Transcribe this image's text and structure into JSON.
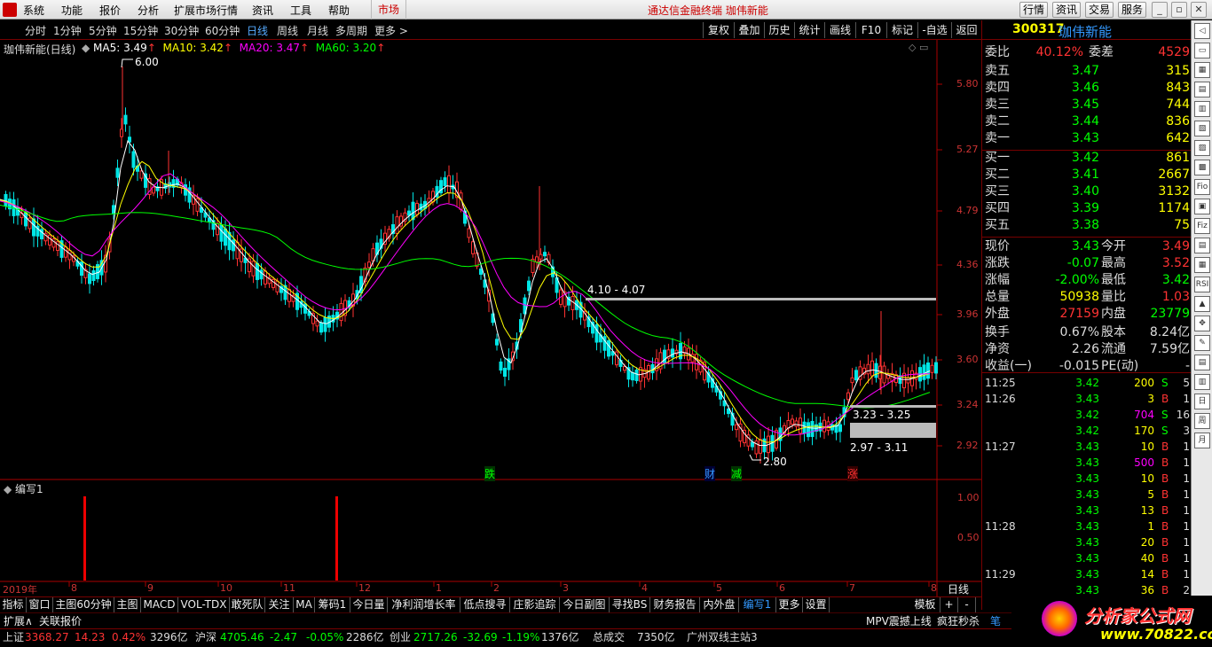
{
  "menubar": {
    "items": [
      "系统",
      "功能",
      "报价",
      "分析",
      "扩展市场行情",
      "资讯",
      "工具",
      "帮助"
    ],
    "market": "市场",
    "title": "通达信金融终端  珈伟新能",
    "right_buttons": [
      "行情",
      "资讯",
      "交易",
      "服务"
    ]
  },
  "toolbar": {
    "periods": [
      "分时",
      "1分钟",
      "5分钟",
      "15分钟",
      "30分钟",
      "60分钟",
      "日线",
      "周线",
      "月线",
      "多周期",
      "更多 >"
    ],
    "active_period": "日线",
    "buttons": [
      "复权",
      "叠加",
      "历史",
      "统计",
      "画线",
      "F10",
      "标记",
      "-自选",
      "返回"
    ]
  },
  "chart": {
    "title": "珈伟新能(日线)",
    "ma": [
      {
        "label": "MA5: 3.49",
        "color": "#ffffff"
      },
      {
        "label": "MA10: 3.42",
        "color": "#ffff00"
      },
      {
        "label": "MA20: 3.47",
        "color": "#ff00ff"
      },
      {
        "label": "MA60: 3.20",
        "color": "#00ff00"
      }
    ],
    "price_labels": [
      "5.80",
      "5.27",
      "4.79",
      "4.36",
      "3.96",
      "3.60",
      "3.24",
      "2.92"
    ],
    "annotations": {
      "high": "6.00",
      "low": "2.80",
      "box1": "4.10 - 4.07",
      "box2": "3.23 - 3.25",
      "box3": "2.97 - 3.11"
    },
    "markers": [
      "跌",
      "财",
      "减",
      "涨"
    ],
    "indicator_title": "编写1",
    "indicator_labels": [
      "1.00",
      "0.50"
    ],
    "date_labels": [
      "2019年",
      "8",
      "9",
      "10",
      "11",
      "12",
      "1",
      "2",
      "3",
      "4",
      "5",
      "6",
      "7",
      "8"
    ],
    "period_label": "日线"
  },
  "tabs": [
    "指标",
    "窗口",
    "主图60分钟",
    "主图",
    "MACD",
    "VOL-TDX",
    "敢死队",
    "关注",
    "MA",
    "筹码1",
    "今日量",
    "净利润增长率",
    "低点搜寻",
    "庄影追踪",
    "今日副图",
    "寻找BS",
    "财务报告",
    "内外盘",
    "编写1",
    "更多",
    "设置"
  ],
  "active_tab": "编写1",
  "tabs_right": [
    "模板",
    "+",
    "-"
  ],
  "idxbar": {
    "left": [
      "扩展∧",
      "关联报价"
    ],
    "right": [
      "MPV震撼上线",
      "疯狂秒杀",
      "笔",
      "价"
    ]
  },
  "ticker": {
    "items": [
      {
        "name": "上证",
        "v": "3368.27",
        "c": "14.23",
        "p": "0.42%",
        "amt": "3296亿"
      },
      {
        "name": "沪深",
        "v": "4705.46",
        "c": "-2.47",
        "p": "-0.05%",
        "amt": "2286亿"
      },
      {
        "name": "创业",
        "v": "2717.26",
        "c": "-32.69",
        "p": "-1.19%",
        "amt": "1376亿"
      }
    ],
    "total_label": "总成交",
    "total": "7350亿",
    "station": "广州双线主站3"
  },
  "quote": {
    "code": "300317",
    "name": "珈伟新能",
    "weibi": "40.12%",
    "weicha": "4529",
    "weibi_label": "委比",
    "weicha_label": "委差",
    "sells": [
      {
        "l": "卖五",
        "p": "3.47",
        "v": "315"
      },
      {
        "l": "卖四",
        "p": "3.46",
        "v": "843"
      },
      {
        "l": "卖三",
        "p": "3.45",
        "v": "744"
      },
      {
        "l": "卖二",
        "p": "3.44",
        "v": "836"
      },
      {
        "l": "卖一",
        "p": "3.43",
        "v": "642"
      }
    ],
    "buys": [
      {
        "l": "买一",
        "p": "3.42",
        "v": "861"
      },
      {
        "l": "买二",
        "p": "3.41",
        "v": "2667"
      },
      {
        "l": "买三",
        "p": "3.40",
        "v": "3132"
      },
      {
        "l": "买四",
        "p": "3.39",
        "v": "1174"
      },
      {
        "l": "买五",
        "p": "3.38",
        "v": "75"
      }
    ],
    "stats": [
      {
        "l1": "现价",
        "v1": "3.43",
        "c1": "g",
        "l2": "今开",
        "v2": "3.49",
        "c2": "r"
      },
      {
        "l1": "涨跌",
        "v1": "-0.07",
        "c1": "g",
        "l2": "最高",
        "v2": "3.52",
        "c2": "r"
      },
      {
        "l1": "涨幅",
        "v1": "-2.00%",
        "c1": "g",
        "l2": "最低",
        "v2": "3.42",
        "c2": "g"
      },
      {
        "l1": "总量",
        "v1": "50938",
        "c1": "y",
        "l2": "量比",
        "v2": "1.03",
        "c2": "r"
      },
      {
        "l1": "外盘",
        "v1": "27159",
        "c1": "r",
        "l2": "内盘",
        "v2": "23779",
        "c2": "g"
      }
    ],
    "stats2": [
      {
        "l1": "换手",
        "v1": "0.67%",
        "l2": "股本",
        "v2": "8.24亿"
      },
      {
        "l1": "净资",
        "v1": "2.26",
        "l2": "流通",
        "v2": "7.59亿"
      },
      {
        "l1": "收益(一)",
        "v1": "-0.015",
        "l2": "PE(动)",
        "v2": "-"
      }
    ],
    "trades": [
      {
        "t": "11:25",
        "p": "3.42",
        "v": "200",
        "s": "S",
        "n": "5",
        "vc": "y"
      },
      {
        "t": "11:26",
        "p": "3.43",
        "v": "3",
        "s": "B",
        "n": "1",
        "vc": "y"
      },
      {
        "t": "",
        "p": "3.42",
        "v": "704",
        "s": "S",
        "n": "16",
        "vc": "m"
      },
      {
        "t": "",
        "p": "3.42",
        "v": "170",
        "s": "S",
        "n": "3",
        "vc": "y"
      },
      {
        "t": "11:27",
        "p": "3.43",
        "v": "10",
        "s": "B",
        "n": "1",
        "vc": "y"
      },
      {
        "t": "",
        "p": "3.43",
        "v": "500",
        "s": "B",
        "n": "1",
        "vc": "m"
      },
      {
        "t": "",
        "p": "3.43",
        "v": "10",
        "s": "B",
        "n": "1",
        "vc": "y"
      },
      {
        "t": "",
        "p": "3.43",
        "v": "5",
        "s": "B",
        "n": "1",
        "vc": "y"
      },
      {
        "t": "",
        "p": "3.43",
        "v": "13",
        "s": "B",
        "n": "1",
        "vc": "y"
      },
      {
        "t": "11:28",
        "p": "3.43",
        "v": "1",
        "s": "B",
        "n": "1",
        "vc": "y"
      },
      {
        "t": "",
        "p": "3.43",
        "v": "20",
        "s": "B",
        "n": "1",
        "vc": "y"
      },
      {
        "t": "",
        "p": "3.43",
        "v": "40",
        "s": "B",
        "n": "1",
        "vc": "y"
      },
      {
        "t": "11:29",
        "p": "3.43",
        "v": "14",
        "s": "B",
        "n": "1",
        "vc": "y"
      },
      {
        "t": "",
        "p": "3.43",
        "v": "36",
        "s": "B",
        "n": "2",
        "vc": "y"
      }
    ]
  },
  "logo": {
    "line1": "分析家公式网",
    "line2": "www.70822.com"
  },
  "toolcol": [
    "◁",
    "▭",
    "▦",
    "▤",
    "▥",
    "▧",
    "▨",
    "▩",
    "Fio",
    "▣",
    "Fiz",
    "▤",
    "▦",
    "RSI",
    "▲",
    "✥",
    "✎",
    "▤",
    "▥",
    "日",
    "周",
    "月"
  ]
}
